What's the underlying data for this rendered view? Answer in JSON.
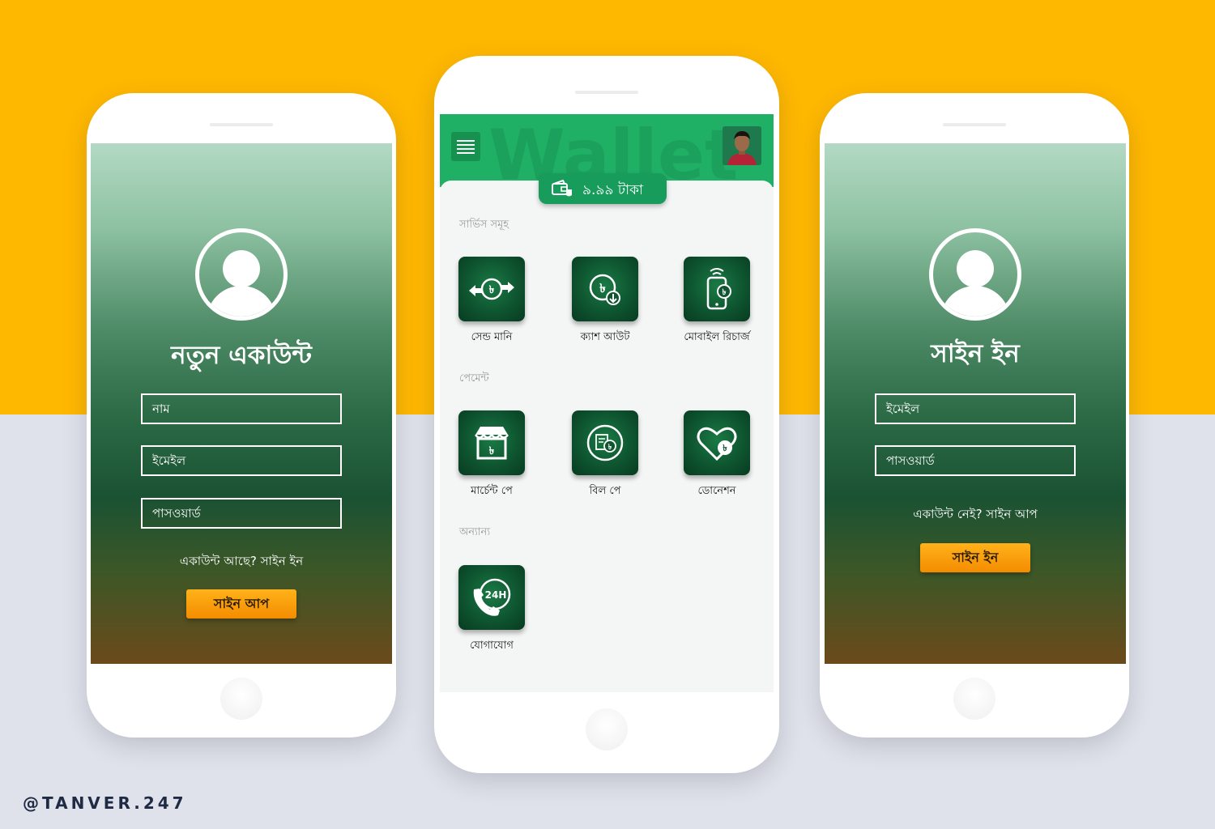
{
  "signup": {
    "title": "নতুন একাউন্ট",
    "name_placeholder": "নাম",
    "email_placeholder": "ইমেইল",
    "password_placeholder": "পাসওয়ার্ড",
    "signin_link": "একাউন্ট আছে? সাইন ইন",
    "submit_label": "সাইন আপ"
  },
  "dashboard": {
    "balance": "৯.৯৯ টাকা",
    "sections": [
      {
        "label": "সার্ভিস সমূহ",
        "items": [
          {
            "label": "সেন্ড মানি",
            "icon": "send-money-icon"
          },
          {
            "label": "ক্যাশ আউট",
            "icon": "cash-out-icon"
          },
          {
            "label": "মোবাইল রিচার্জ",
            "icon": "mobile-recharge-icon"
          }
        ]
      },
      {
        "label": "পেমেন্ট",
        "items": [
          {
            "label": "মার্চেন্ট পে",
            "icon": "merchant-pay-icon"
          },
          {
            "label": "বিল পে",
            "icon": "bill-pay-icon"
          },
          {
            "label": "ডোনেশন",
            "icon": "donation-icon"
          }
        ]
      },
      {
        "label": "অন্যান্য",
        "items": [
          {
            "label": "যোগাযোগ",
            "icon": "support-24h-icon",
            "badge": "24H"
          }
        ]
      }
    ]
  },
  "signin": {
    "title": "সাইন ইন",
    "email_placeholder": "ইমেইল",
    "password_placeholder": "পাসওয়ার্ড",
    "signup_link": "একাউন্ট নেই? সাইন আপ",
    "submit_label": "সাইন ইন"
  },
  "watermark": "@TANVER.247",
  "colors": {
    "background_top": "#ffb800",
    "background_bottom": "#dfe2ea",
    "header_green": "#1fb066",
    "button_orange": "#f48c00"
  }
}
